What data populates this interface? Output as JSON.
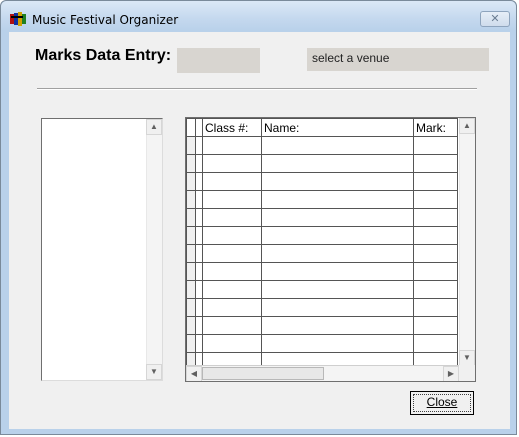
{
  "window": {
    "title": "Music Festival Organizer",
    "close_glyph": "✕"
  },
  "form": {
    "heading": "Marks Data Entry:",
    "field_value": "",
    "venue_text": "select a venue"
  },
  "grid": {
    "columns": [
      "",
      "Class #:",
      "Name:",
      "Mark:"
    ],
    "rows": [
      [
        "",
        "",
        "",
        ""
      ],
      [
        "",
        "",
        "",
        ""
      ],
      [
        "",
        "",
        "",
        ""
      ],
      [
        "",
        "",
        "",
        ""
      ],
      [
        "",
        "",
        "",
        ""
      ],
      [
        "",
        "",
        "",
        ""
      ],
      [
        "",
        "",
        "",
        ""
      ],
      [
        "",
        "",
        "",
        ""
      ],
      [
        "",
        "",
        "",
        ""
      ],
      [
        "",
        "",
        "",
        ""
      ],
      [
        "",
        "",
        "",
        ""
      ],
      [
        "",
        "",
        "",
        ""
      ],
      [
        "",
        "",
        "",
        ""
      ]
    ]
  },
  "buttons": {
    "close_label": "Close"
  },
  "scroll": {
    "up": "▲",
    "down": "▼",
    "left": "◀",
    "right": "▶"
  },
  "icons": {
    "app": "music-app-icon"
  }
}
